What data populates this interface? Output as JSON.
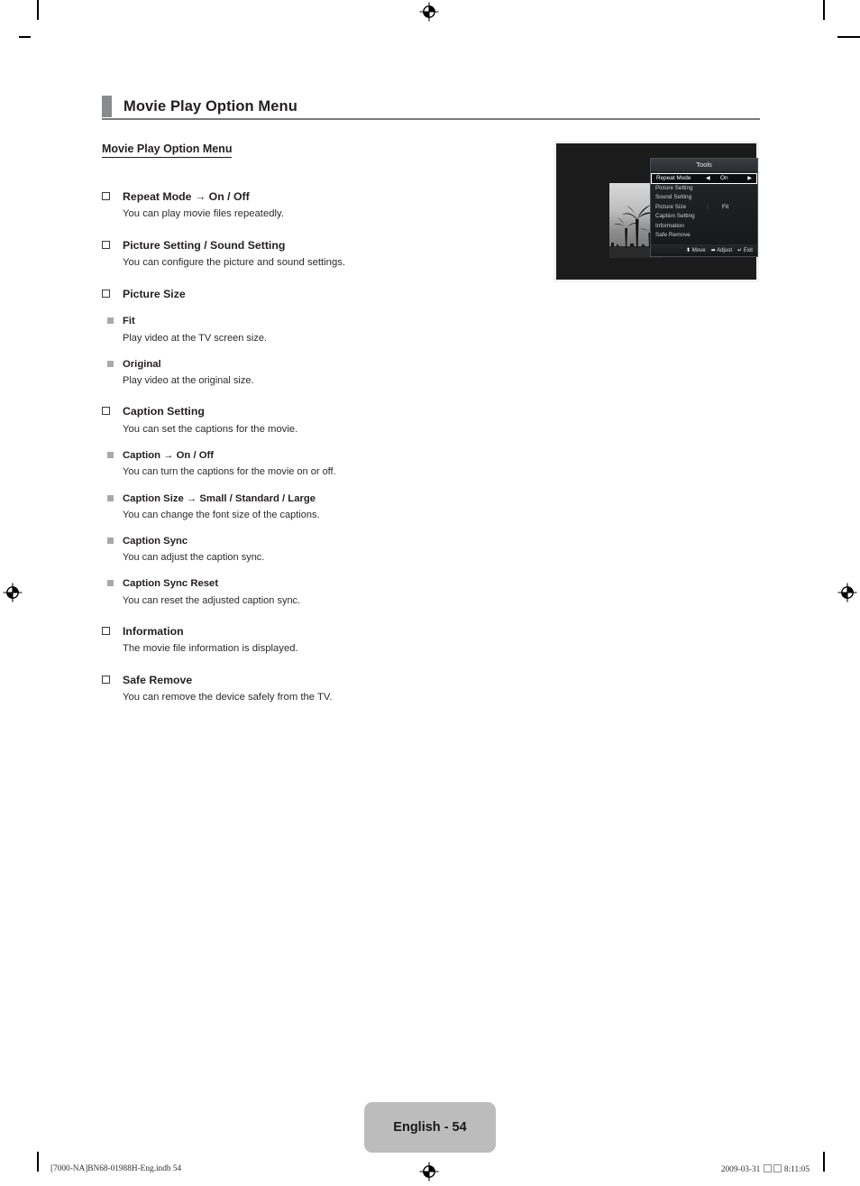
{
  "header": {
    "title": "Movie Play Option Menu"
  },
  "section": {
    "label": "Movie Play Option Menu"
  },
  "entries": [
    {
      "level": 1,
      "head": "Repeat Mode → On / Off",
      "desc": "You can play movie files repeatedly."
    },
    {
      "level": 1,
      "head": "Picture Setting / Sound Setting",
      "desc": "You can configure the picture and sound settings."
    },
    {
      "level": 1,
      "head": "Picture Size",
      "desc": ""
    },
    {
      "level": 2,
      "head": "Fit",
      "desc": "Play video at the TV screen size."
    },
    {
      "level": 2,
      "head": "Original",
      "desc": "Play video at the original size."
    },
    {
      "level": 1,
      "head": "Caption Setting",
      "desc": "You can set the captions for the movie."
    },
    {
      "level": 2,
      "head": "Caption → On / Off",
      "desc": "You can turn the captions for the movie on or off."
    },
    {
      "level": 2,
      "head": "Caption Size → Small / Standard / Large",
      "desc": "You can change the font size of the captions."
    },
    {
      "level": 2,
      "head": "Caption Sync",
      "desc": "You can adjust the caption sync."
    },
    {
      "level": 2,
      "head": "Caption Sync Reset",
      "desc": "You can reset the adjusted caption sync."
    },
    {
      "level": 1,
      "head": "Information",
      "desc": "The movie file information is displayed."
    },
    {
      "level": 1,
      "head": "Safe Remove",
      "desc": "You can remove the device safely from the TV."
    }
  ],
  "figure": {
    "osd_title": "Tools",
    "rows": [
      {
        "label": "Repeat Mode",
        "value": "On",
        "selected": true,
        "colon": false,
        "arrows": true
      },
      {
        "label": "Picture Setting",
        "value": "",
        "selected": false,
        "colon": false,
        "arrows": false
      },
      {
        "label": "Sound Setting",
        "value": "",
        "selected": false,
        "colon": false,
        "arrows": false
      },
      {
        "label": "Picture Size",
        "value": "Fit",
        "selected": false,
        "colon": true,
        "arrows": false
      },
      {
        "label": "Caption Setting",
        "value": "",
        "selected": false,
        "colon": false,
        "arrows": false
      },
      {
        "label": "Information",
        "value": "",
        "selected": false,
        "colon": false,
        "arrows": false
      },
      {
        "label": "Safe Remove",
        "value": "",
        "selected": false,
        "colon": false,
        "arrows": false
      }
    ],
    "hints": [
      {
        "glyph": "⬍",
        "label": "Move"
      },
      {
        "glyph": "⬌",
        "label": "Adjust"
      },
      {
        "glyph": "↵",
        "label": "Exit"
      }
    ]
  },
  "footer": {
    "page_badge": "English - 54",
    "file_info": "[7000-NA]BN68-01988H-Eng.indb   54",
    "timestamp_date": "2009-03-31",
    "timestamp_time": "8:11:05"
  },
  "colors": {
    "header_tab": "#888a8c",
    "header_rule": "#77797b",
    "badge_bg": "#bcbcbc",
    "bullet_lvl2": "#a7a9ac",
    "text": "#231f20"
  }
}
